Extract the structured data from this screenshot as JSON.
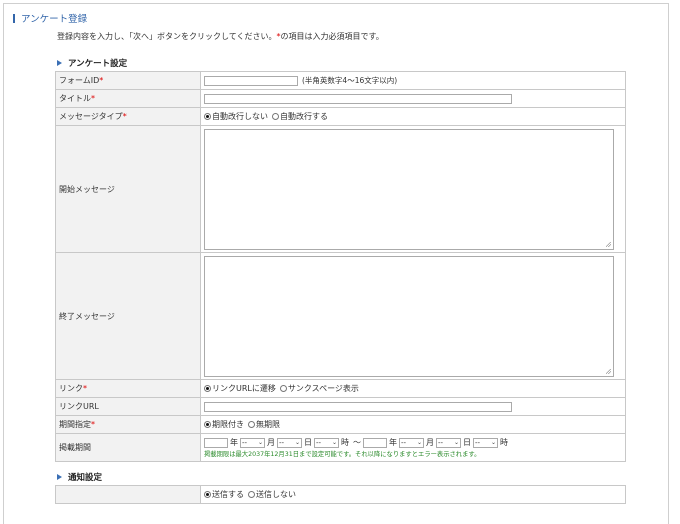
{
  "page": {
    "title": "アンケート登録",
    "intro_before": "登録内容を入力し、「次へ」ボタンをクリックしてください。",
    "intro_mark": "*",
    "intro_after": "の項目は入力必須項目です。"
  },
  "section_survey": {
    "heading": "アンケート設定",
    "form_id": {
      "label": "フォームID",
      "required_mark": "*",
      "value": "",
      "hint": "(半角英数字4～16文字以内)"
    },
    "title": {
      "label": "タイトル",
      "required_mark": "*",
      "value": ""
    },
    "message_type": {
      "label": "メッセージタイプ",
      "required_mark": "*",
      "options": [
        {
          "label": "自動改行しない",
          "checked": true
        },
        {
          "label": "自動改行する",
          "checked": false
        }
      ]
    },
    "start_message": {
      "label": "開始メッセージ",
      "value": ""
    },
    "end_message": {
      "label": "終了メッセージ",
      "value": ""
    },
    "link": {
      "label": "リンク",
      "required_mark": "*",
      "options": [
        {
          "label": "リンクURLに遷移",
          "checked": true
        },
        {
          "label": "サンクスページ表示",
          "checked": false
        }
      ]
    },
    "link_url": {
      "label": "リンクURL",
      "value": ""
    },
    "period_type": {
      "label": "期間指定",
      "required_mark": "*",
      "options": [
        {
          "label": "期限付き",
          "checked": true
        },
        {
          "label": "無期限",
          "checked": false
        }
      ]
    },
    "publish_period": {
      "label": "掲載期間",
      "year_unit": "年",
      "month_unit": "月",
      "day_unit": "日",
      "hour_unit": "時",
      "range_sep": "～",
      "select_placeholder": "--",
      "note": "掲載期限は最大2037年12月31日まで設定可能です。それ以降になりますとエラー表示されます。"
    }
  },
  "section_notify": {
    "heading": "通知設定",
    "send": {
      "label": "",
      "options": [
        {
          "label": "送信する",
          "checked": true
        },
        {
          "label": "送信しない",
          "checked": false
        }
      ]
    }
  },
  "colors": {
    "accent": "#3366aa",
    "required": "#dd0000",
    "label_bg": "#f2f2f2",
    "note": "#2a8a2a"
  }
}
